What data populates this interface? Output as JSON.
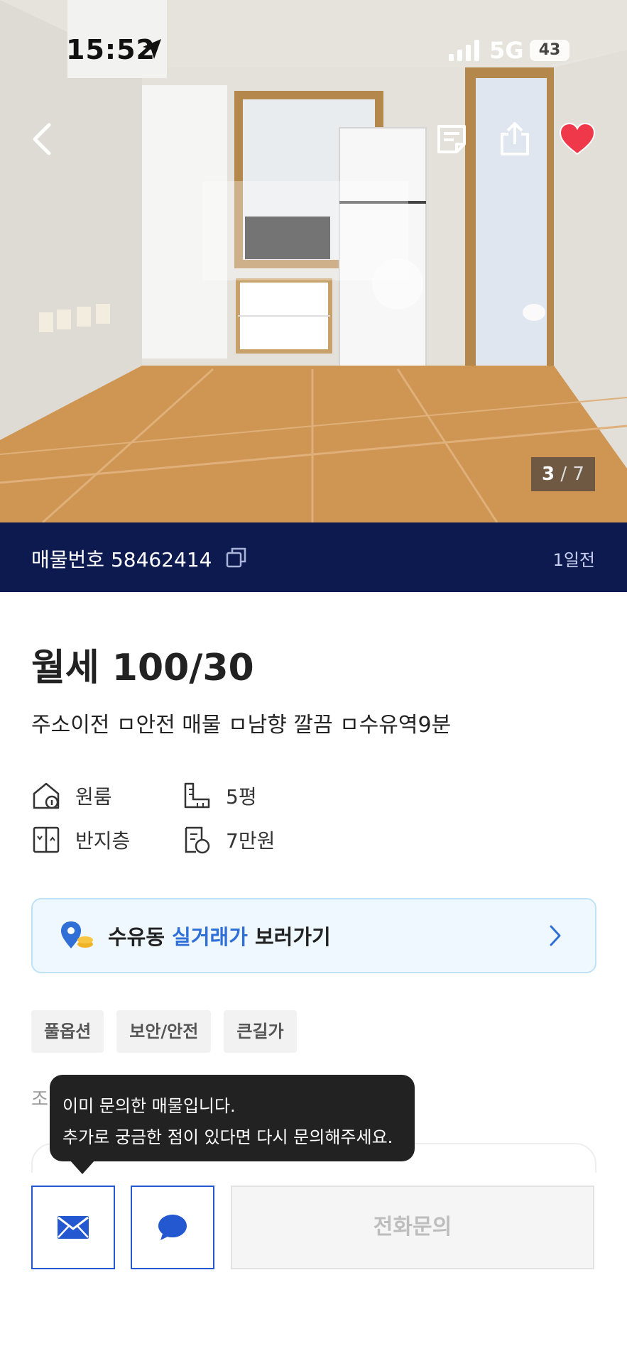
{
  "status_bar": {
    "time": "15:52",
    "network": "5G",
    "battery": "43"
  },
  "gallery": {
    "current": "3",
    "separator": "/",
    "total": "7"
  },
  "listing": {
    "id_label": "매물번호 58462414",
    "posted": "1일전"
  },
  "price": "월세 100/30",
  "subtitle": "주소이전 ㅁ안전 매물 ㅁ남향 깔끔 ㅁ수유역9분",
  "specs": [
    {
      "icon": "house-info-icon",
      "label": "원룸"
    },
    {
      "icon": "floor-plan-icon",
      "label": "5평"
    },
    {
      "icon": "floor-level-icon",
      "label": "반지층"
    },
    {
      "icon": "maintenance-fee-icon",
      "label": "7만원"
    }
  ],
  "price_banner": {
    "area": "수유동",
    "highlight": "실거래가",
    "suffix": "보러가기"
  },
  "tags": [
    "풀옵션",
    "보안/안전",
    "큰길가"
  ],
  "partial_label": "조",
  "tooltip": {
    "line1": "이미 문의한 매물입니다.",
    "line2": "추가로 궁금한 점이 있다면 다시 문의해주세요."
  },
  "actions": {
    "call_label": "전화문의"
  },
  "colors": {
    "listing_bar": "#0d1a50",
    "accent": "#2358d1",
    "heart": "#f0384b",
    "highlight": "#2f6fd6"
  }
}
